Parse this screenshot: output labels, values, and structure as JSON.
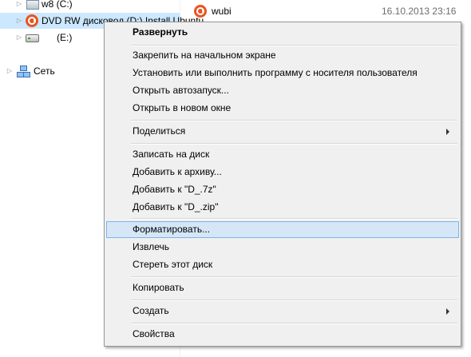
{
  "nav_tree": {
    "drive_c_label": "w8 (C:)",
    "dvd_drive_label": "DVD RW дисковод (D:) Install Ubuntu",
    "drive_e_label": "(E:)",
    "network_label": "Сеть"
  },
  "file_list": {
    "rows": [
      {
        "name": "wubi",
        "date": "16.10.2013 23:16"
      }
    ]
  },
  "context_menu": {
    "items": [
      {
        "label": "Развернуть"
      },
      {
        "label": "Закрепить на начальном экране"
      },
      {
        "label": "Установить или выполнить программу с носителя пользователя"
      },
      {
        "label": "Открыть автозапуск..."
      },
      {
        "label": "Открыть в новом окне"
      },
      {
        "label": "Поделиться"
      },
      {
        "label": "Записать на диск"
      },
      {
        "label": "Добавить к архиву..."
      },
      {
        "label": "Добавить к \"D_.7z\""
      },
      {
        "label": "Добавить к \"D_.zip\""
      },
      {
        "label": "Форматировать..."
      },
      {
        "label": "Извлечь"
      },
      {
        "label": "Стереть этот диск"
      },
      {
        "label": "Копировать"
      },
      {
        "label": "Создать"
      },
      {
        "label": "Свойства"
      }
    ],
    "highlighted_item": "Форматировать..."
  },
  "colors": {
    "selection": "#cce8ff",
    "menu_background": "#f0f0f0",
    "menu_highlight": "#d5e7f7",
    "menu_highlight_border": "#7eb4ea",
    "ubuntu_orange": "#e95420"
  },
  "icons": {
    "drive_c": "windows-drive-icon",
    "dvd_drive": "ubuntu-icon",
    "drive_e": "removable-drive-icon",
    "network": "network-icon",
    "wubi": "ubuntu-icon"
  }
}
